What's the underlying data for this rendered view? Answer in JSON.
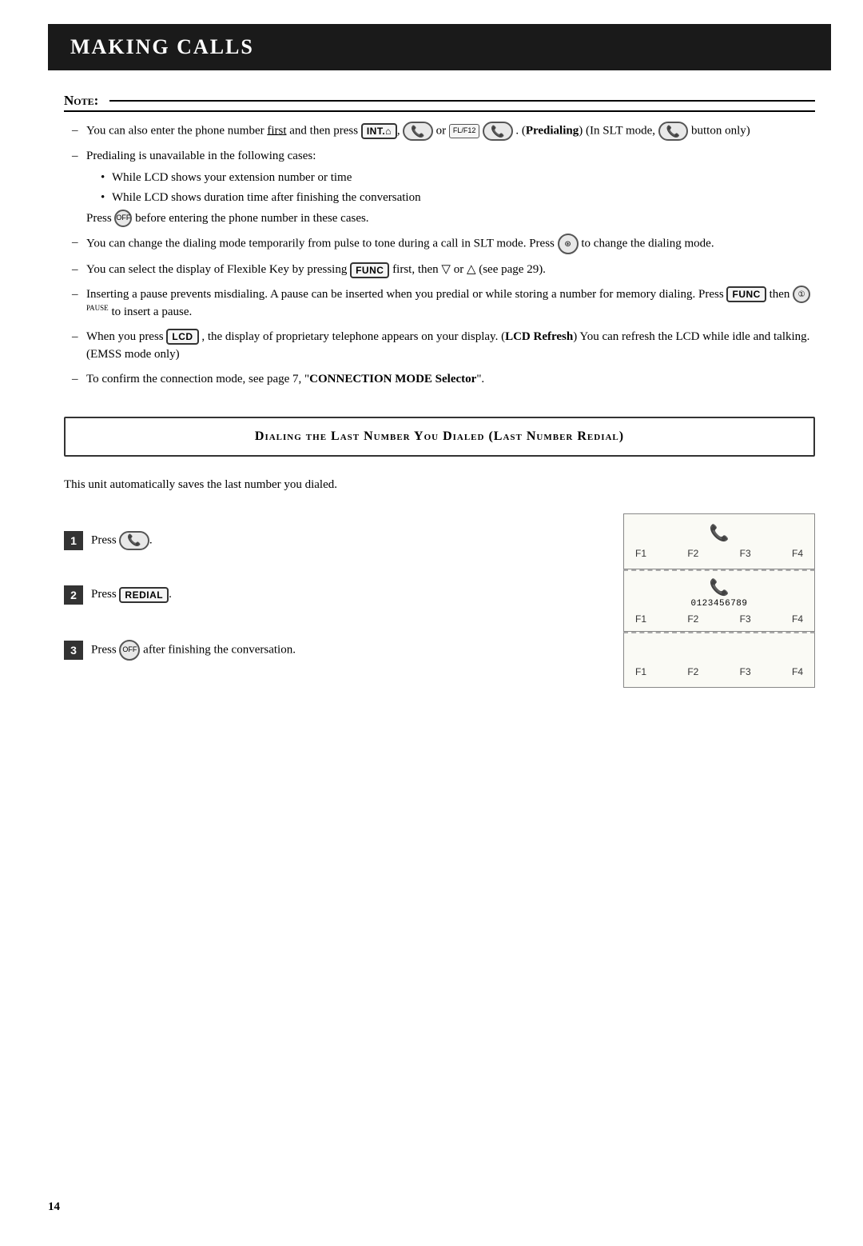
{
  "header": {
    "title": "Making Calls"
  },
  "note": {
    "label": "Note:",
    "items": [
      {
        "text": "You can also enter the phone number first and then press",
        "buttons": [
          "INT.M",
          "handset",
          "or",
          "FL/F12"
        ],
        "suffix": ". (Predialing) (In SLT mode,",
        "suffix2": "button only)"
      },
      {
        "text": "Predialing is unavailable in the following cases:",
        "subitems": [
          "While LCD shows your extension number or time",
          "While LCD shows duration time after finishing the conversation"
        ],
        "extra": "Press ⊙ before entering the phone number in these cases."
      },
      {
        "text": "You can change the dialing mode temporarily from pulse to tone during a call in SLT mode. Press ⊛ to change the dialing mode."
      },
      {
        "text": "You can select the display of Flexible Key by pressing [FUNC] first, then ▽ or △ (see page 29)."
      },
      {
        "text": "Inserting a pause prevents misdialing. A pause can be inserted when you predial or while storing a number for memory dialing. Press [FUNC] then ① to insert a pause."
      },
      {
        "text": "When you press [LCD], the display of proprietary telephone appears on your display. (LCD Refresh) You can refresh the LCD while idle and talking. (EMSS mode only)"
      },
      {
        "text": "To confirm the connection mode, see page 7, \"CONNECTION MODE Selector\"."
      }
    ]
  },
  "dialing_section": {
    "title": "Dialing the Last Number You Dialed (Last Number Redial)",
    "description": "This unit automatically saves the last number you dialed.",
    "steps": [
      {
        "number": "1",
        "text": "Press",
        "button": "handset",
        "suffix": "."
      },
      {
        "number": "2",
        "text": "Press",
        "button": "REDIAL",
        "suffix": "."
      },
      {
        "number": "3",
        "text": "Press",
        "button": "off",
        "suffix": "after finishing the conversation."
      }
    ],
    "panels": [
      {
        "icon": "📞",
        "fkeys": [
          "F1",
          "F2",
          "F3",
          "F4"
        ],
        "number": ""
      },
      {
        "icon": "📞",
        "fkeys": [
          "F1",
          "F2",
          "F3",
          "F4"
        ],
        "number": "0123456789"
      },
      {
        "icon": "",
        "fkeys": [
          "F1",
          "F2",
          "F3",
          "F4"
        ],
        "number": ""
      }
    ]
  },
  "page_number": "14"
}
